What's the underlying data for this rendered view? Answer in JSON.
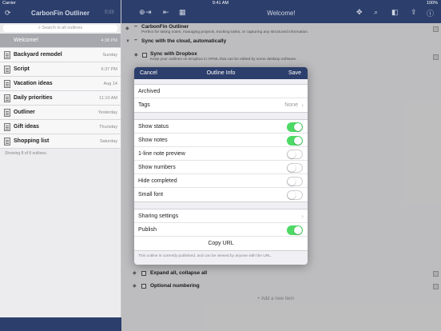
{
  "status": {
    "carrier": "Carrier",
    "time": "9:41 AM",
    "battery": "100%"
  },
  "sidebar": {
    "title": "CarbonFin Outliner",
    "edit": "Edit",
    "search_placeholder": "Search in all outlines",
    "items": [
      {
        "name": "Welcome!",
        "when": "4:38 PM",
        "selected": true
      },
      {
        "name": "Backyard remodel",
        "when": "Sunday"
      },
      {
        "name": "Script",
        "when": "6:37 PM"
      },
      {
        "name": "Vacation ideas",
        "when": "Aug 14"
      },
      {
        "name": "Daily priorities",
        "when": "11:10 AM"
      },
      {
        "name": "Outliner",
        "when": "Yesterday"
      },
      {
        "name": "Gift ideas",
        "when": "Thursday"
      },
      {
        "name": "Shopping list",
        "when": "Saturday"
      }
    ],
    "footer": "Showing 8 of 8 outlines."
  },
  "main": {
    "title": "Welcome!",
    "rows": [
      {
        "title": "CarbonFin Outliner",
        "note": "Perfect for taking notes, managing projects, tracking tasks, or capturing any structured information."
      },
      {
        "title": "Sync with the cloud, automatically"
      },
      {
        "title": "Sync with Dropbox",
        "note": "Keep your outlines on Dropbox in OPML that can be edited by some desktop software."
      }
    ],
    "bottom_rows": [
      {
        "title": "Expand all, collapse all"
      },
      {
        "title": "Optional numbering"
      }
    ],
    "add_item": "Add a new item"
  },
  "modal": {
    "cancel": "Cancel",
    "title": "Outline Info",
    "save": "Save",
    "archived_label": "Archived",
    "tags_label": "Tags",
    "tags_value": "None",
    "options": [
      {
        "label": "Show status",
        "on": true
      },
      {
        "label": "Show notes",
        "on": true
      },
      {
        "label": "1-line note preview",
        "on": false
      },
      {
        "label": "Show numbers",
        "on": false
      },
      {
        "label": "Hide completed",
        "on": false
      },
      {
        "label": "Small font",
        "on": false
      }
    ],
    "sharing_label": "Sharing settings",
    "publish_label": "Publish",
    "publish_on": true,
    "copy_url": "Copy URL",
    "footer": "This outline is currently published, and can be viewed by anyone with the URL."
  },
  "colors": {
    "nav": "#2c3e6b",
    "toggle_on": "#4cd964",
    "selected_row": "#a6a8ae"
  }
}
